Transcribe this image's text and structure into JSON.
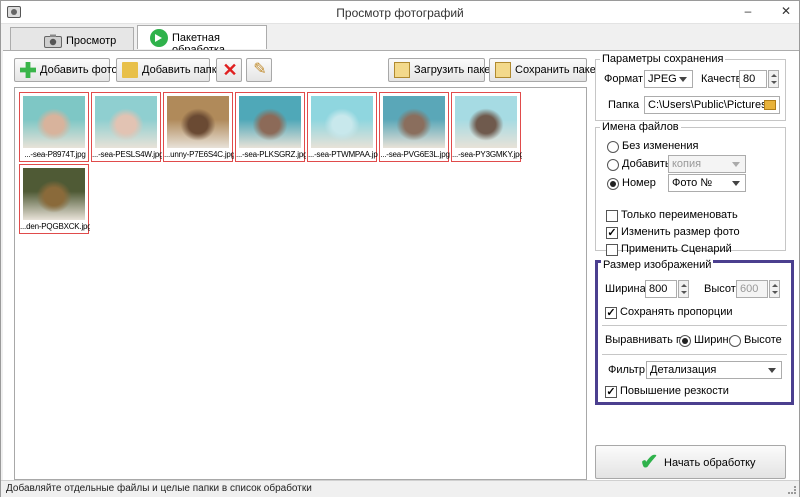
{
  "window": {
    "title": "Просмотр фотографий",
    "min": "–",
    "max": "□",
    "close": "✕"
  },
  "tabs": [
    {
      "label": "Просмотр"
    },
    {
      "label": "Пакетная обработка"
    }
  ],
  "toolbar": {
    "add_photo": "Добавить фото",
    "add_folder": "Добавить папку",
    "load_pack": "Загрузить пакет",
    "save_pack": "Сохранить пакет"
  },
  "files": [
    {
      "name": "...-sea-P8974T.jpg",
      "c1": "#7ec7c5",
      "c2": "#d8b39c"
    },
    {
      "name": "...-sea-PESLS4W.jpg",
      "c1": "#8fcfd0",
      "c2": "#e2c3b3"
    },
    {
      "name": "...unny-P7E6S4C.jpg",
      "c1": "#b08a5a",
      "c2": "#6a4a33"
    },
    {
      "name": "...-sea-PLKSGRZ.jpg",
      "c1": "#4fa8b8",
      "c2": "#8c6a58"
    },
    {
      "name": "...-sea-PTWMPAA.jpg",
      "c1": "#8fd6df",
      "c2": "#c8e8ec"
    },
    {
      "name": "...-sea-PVG6E3L.jpg",
      "c1": "#5aa7b8",
      "c2": "#8a6e5d"
    },
    {
      "name": "...-sea-PY3GMKY.jpg",
      "c1": "#a6dbe3",
      "c2": "#6f5a4d"
    },
    {
      "name": "...den-PQGBXCK.jpg",
      "c1": "#4f5a35",
      "c2": "#8a6a3a"
    }
  ],
  "save": {
    "group": "Параметры сохранения",
    "format_label": "Формат",
    "format": "JPEG",
    "quality_label": "Качество",
    "quality": "80",
    "folder_label": "Папка",
    "folder": "C:\\Users\\Public\\Pictures"
  },
  "names": {
    "group": "Имена файлов",
    "no_change": "Без изменения",
    "add": "Добавить",
    "add_value": "копия",
    "number": "Номер",
    "number_value": "Фото №"
  },
  "options": {
    "rename_only": "Только переименовать",
    "resize": "Изменить размер фото",
    "scenario": "Применить Сценарий"
  },
  "size": {
    "group": "Размер изображений",
    "width_label": "Ширина",
    "width": "800",
    "height_label": "Высота",
    "height": "600",
    "keep": "Сохранять пропорции",
    "align_label": "Выравнивать по:",
    "align_width": "Ширине",
    "align_height": "Высоте",
    "filter_label": "Фильтр",
    "filter": "Детализация",
    "sharpen": "Повышение резкости"
  },
  "start": "Начать обработку",
  "status": "Добавляйте отдельные файлы и целые папки в список обработки",
  "colors": {
    "highlight": "#4b3f8f",
    "thumb_border": "#e04b4b",
    "accent": "#2fb24b"
  }
}
